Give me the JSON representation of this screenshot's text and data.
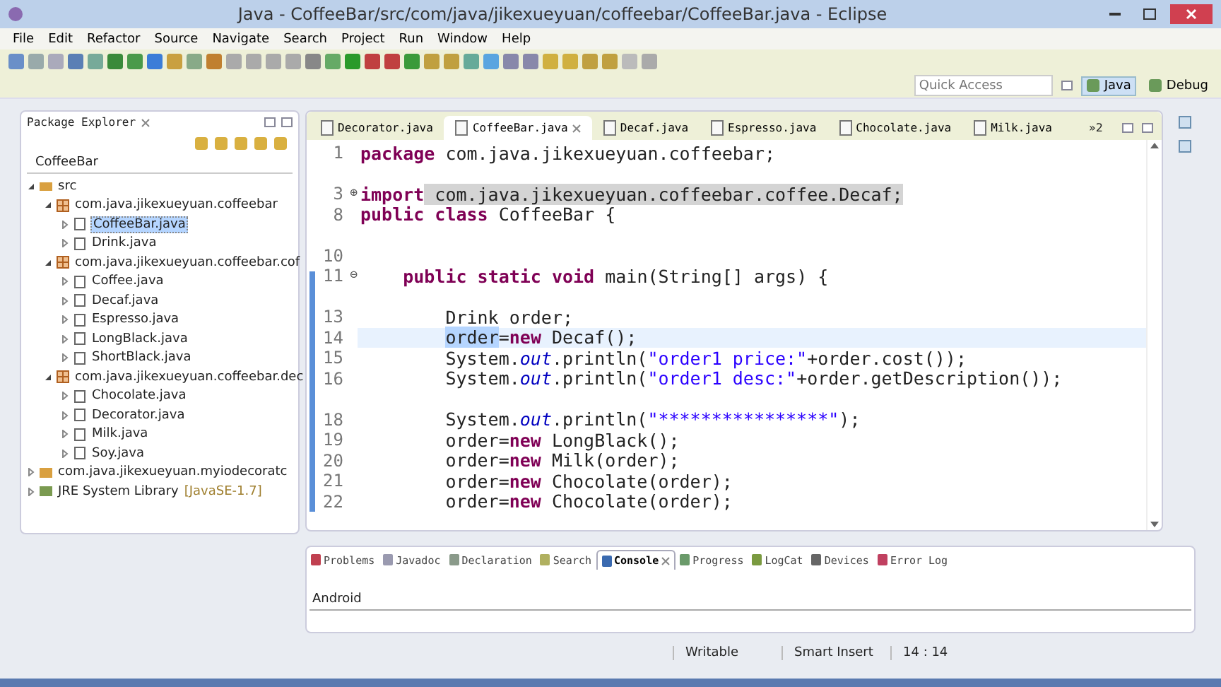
{
  "window": {
    "title": "Java - CoffeeBar/src/com/java/jikexueyuan/coffeebar/CoffeeBar.java - Eclipse"
  },
  "menu": [
    "File",
    "Edit",
    "Refactor",
    "Source",
    "Navigate",
    "Search",
    "Project",
    "Run",
    "Window",
    "Help"
  ],
  "quick_access": {
    "placeholder": "Quick Access"
  },
  "perspectives": [
    {
      "label": "Java",
      "selected": true
    },
    {
      "label": "Debug",
      "selected": false
    }
  ],
  "package_explorer": {
    "title": "Package Explorer",
    "project": "CoffeeBar",
    "tree": [
      {
        "label": "src",
        "kind": "folder",
        "expanded": true,
        "selected": false,
        "children": [
          {
            "label": "com.java.jikexueyuan.coffeebar",
            "kind": "package",
            "expanded": true,
            "selected": false,
            "children": [
              {
                "label": "CoffeeBar.java",
                "kind": "file",
                "expanded": false,
                "selected": true
              },
              {
                "label": "Drink.java",
                "kind": "file",
                "expanded": false,
                "selected": false
              }
            ]
          },
          {
            "label": "com.java.jikexueyuan.coffeebar.cof",
            "kind": "package",
            "expanded": true,
            "selected": false,
            "children": [
              {
                "label": "Coffee.java",
                "kind": "file",
                "expanded": false,
                "selected": false
              },
              {
                "label": "Decaf.java",
                "kind": "file",
                "expanded": false,
                "selected": false
              },
              {
                "label": "Espresso.java",
                "kind": "file",
                "expanded": false,
                "selected": false
              },
              {
                "label": "LongBlack.java",
                "kind": "file",
                "expanded": false,
                "selected": false
              },
              {
                "label": "ShortBlack.java",
                "kind": "file",
                "expanded": false,
                "selected": false
              }
            ]
          },
          {
            "label": "com.java.jikexueyuan.coffeebar.dec",
            "kind": "package",
            "expanded": true,
            "selected": false,
            "children": [
              {
                "label": "Chocolate.java",
                "kind": "file",
                "expanded": false,
                "selected": false
              },
              {
                "label": "Decorator.java",
                "kind": "file",
                "expanded": false,
                "selected": false
              },
              {
                "label": "Milk.java",
                "kind": "file",
                "expanded": false,
                "selected": false
              },
              {
                "label": "Soy.java",
                "kind": "file",
                "expanded": false,
                "selected": false
              }
            ]
          }
        ]
      },
      {
        "label": "com.java.jikexueyuan.myiodecoratc",
        "kind": "project",
        "expanded": false,
        "selected": false
      },
      {
        "label": "JRE System Library",
        "suffix": "[JavaSE-1.7]",
        "kind": "library",
        "expanded": false,
        "selected": false
      }
    ]
  },
  "editor_tabs": [
    {
      "label": "Decorator.java",
      "selected": false
    },
    {
      "label": "CoffeeBar.java",
      "selected": true
    },
    {
      "label": "Decaf.java",
      "selected": false
    },
    {
      "label": "Espresso.java",
      "selected": false
    },
    {
      "label": "Chocolate.java",
      "selected": false
    },
    {
      "label": "Milk.java",
      "selected": false
    }
  ],
  "editor_tabs_overflow": "»2",
  "code": [
    {
      "number": "1",
      "current": false,
      "segments": [
        {
          "kind": "keyword",
          "text": "package"
        },
        {
          "kind": "plain",
          "text": " com.java.jikexueyuan.coffeebar;"
        }
      ]
    },
    {
      "current": false
    },
    {
      "number": "3",
      "fold_marker": "⊕",
      "current": false,
      "segments": [
        {
          "kind": "keyword",
          "text": "import"
        },
        {
          "kind": "marked",
          "text": " com.java.jikexueyuan.coffeebar.coffee.Decaf;"
        }
      ]
    },
    {
      "number": "8",
      "current": false,
      "segments": [
        {
          "kind": "keyword",
          "text": "public"
        },
        {
          "kind": "keyword",
          "text": " class"
        },
        {
          "kind": "plain",
          "text": " CoffeeBar {"
        }
      ]
    },
    {
      "current": false
    },
    {
      "number": "10",
      "current": false
    },
    {
      "number": "11",
      "fold_marker": "⊖",
      "current": false,
      "segments": [
        {
          "kind": "keyword",
          "text": "    public"
        },
        {
          "kind": "keyword",
          "text": " static"
        },
        {
          "kind": "keyword",
          "text": " void"
        },
        {
          "kind": "plain",
          "text": " main(String[] args) {"
        }
      ]
    },
    {
      "current": false
    },
    {
      "number": "13",
      "current": false,
      "segments": [
        {
          "kind": "plain",
          "text": "        Drink order;"
        }
      ]
    },
    {
      "number": "14",
      "current": true,
      "segments": [
        {
          "kind": "selected",
          "text": "        order"
        },
        {
          "kind": "plain",
          "text": "="
        },
        {
          "kind": "keyword",
          "text": "new"
        },
        {
          "kind": "plain",
          "text": " Decaf();"
        }
      ]
    },
    {
      "number": "15",
      "current": false,
      "segments": [
        {
          "kind": "plain",
          "text": "        System."
        },
        {
          "kind": "field",
          "text": "out"
        },
        {
          "kind": "plain",
          "text": ".println("
        },
        {
          "kind": "string",
          "text": "\"order1 price:\""
        },
        {
          "kind": "plain",
          "text": "+order.cost());"
        }
      ]
    },
    {
      "number": "16",
      "current": false,
      "segments": [
        {
          "kind": "plain",
          "text": "        System."
        },
        {
          "kind": "field",
          "text": "out"
        },
        {
          "kind": "plain",
          "text": ".println("
        },
        {
          "kind": "string",
          "text": "\"order1 desc:\""
        },
        {
          "kind": "plain",
          "text": "+order.getDescription());"
        }
      ]
    },
    {
      "current": false
    },
    {
      "number": "18",
      "current": false,
      "segments": [
        {
          "kind": "plain",
          "text": "        System."
        },
        {
          "kind": "field",
          "text": "out"
        },
        {
          "kind": "plain",
          "text": ".println("
        },
        {
          "kind": "string",
          "text": "\"****************\""
        },
        {
          "kind": "plain",
          "text": ");"
        }
      ]
    },
    {
      "number": "19",
      "current": false,
      "segments": [
        {
          "kind": "plain",
          "text": "        order="
        },
        {
          "kind": "keyword",
          "text": "new"
        },
        {
          "kind": "plain",
          "text": " LongBlack();"
        }
      ]
    },
    {
      "number": "20",
      "current": false,
      "segments": [
        {
          "kind": "plain",
          "text": "        order="
        },
        {
          "kind": "keyword",
          "text": "new"
        },
        {
          "kind": "plain",
          "text": " Milk(order);"
        }
      ]
    },
    {
      "number": "21",
      "current": false,
      "segments": [
        {
          "kind": "plain",
          "text": "        order="
        },
        {
          "kind": "keyword",
          "text": "new"
        },
        {
          "kind": "plain",
          "text": " Chocolate(order);"
        }
      ]
    },
    {
      "number": "22",
      "current": false,
      "segments": [
        {
          "kind": "plain",
          "text": "        order="
        },
        {
          "kind": "keyword",
          "text": "new"
        },
        {
          "kind": "plain",
          "text": " Chocolate(order);"
        }
      ]
    }
  ],
  "bottom_tabs": [
    {
      "label": "Problems",
      "selected": false
    },
    {
      "label": "Javadoc",
      "selected": false
    },
    {
      "label": "Declaration",
      "selected": false
    },
    {
      "label": "Search",
      "selected": false
    },
    {
      "label": "Console",
      "selected": true
    },
    {
      "label": "Progress",
      "selected": false
    },
    {
      "label": "LogCat",
      "selected": false
    },
    {
      "label": "Devices",
      "selected": false
    },
    {
      "label": "Error Log",
      "selected": false
    }
  ],
  "console": {
    "title": "Android"
  },
  "status_bar": [
    "Writable",
    "Smart Insert",
    "14 : 14"
  ]
}
